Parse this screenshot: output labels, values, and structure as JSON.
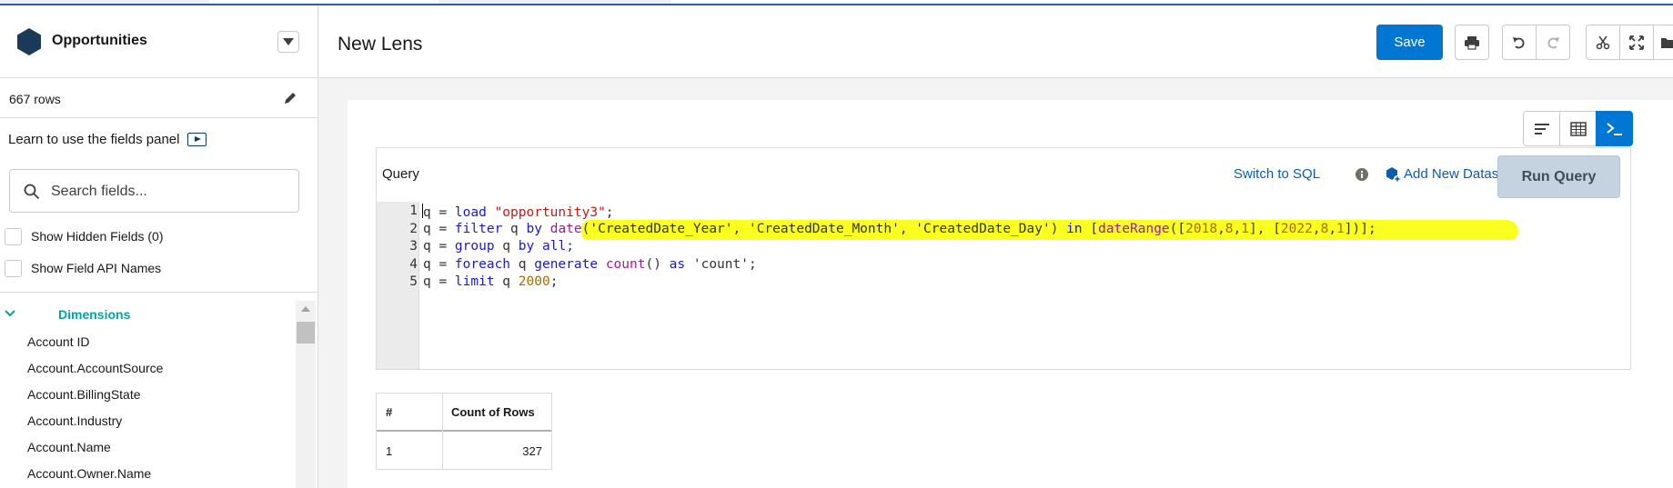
{
  "sidebar": {
    "dataset_title": "Opportunities",
    "row_count": "667 rows",
    "learn_text": "Learn to use the fields panel",
    "search": {
      "placeholder": "Search fields..."
    },
    "show_hidden": "Show Hidden Fields (0)",
    "show_api_names": "Show Field API Names",
    "dimensions_label": "Dimensions",
    "fields": [
      "Account ID",
      "Account.AccountSource",
      "Account.BillingState",
      "Account.Industry",
      "Account.Name",
      "Account.Owner.Name"
    ]
  },
  "header": {
    "lens_title": "New Lens",
    "save_label": "Save"
  },
  "query": {
    "label": "Query",
    "switch_sql": "Switch to SQL",
    "add_dataset": "Add New Dataset",
    "run_label": "Run Query",
    "line_numbers": [
      "1",
      "2",
      "3",
      "4",
      "5"
    ],
    "lines": [
      "q = load \"opportunity3\";",
      "q = filter q by date('CreatedDate_Year', 'CreatedDate_Month', 'CreatedDate_Day') in [dateRange([2018,8,1], [2022,8,1])];",
      "q = group q by all;",
      "q = foreach q generate count() as 'count';",
      "q = limit q 2000;"
    ]
  },
  "results": {
    "headers": [
      "#",
      "Count of Rows"
    ],
    "rows": [
      [
        "1",
        "327"
      ]
    ]
  },
  "colors": {
    "primary": "#0176d3",
    "highlight": "#fbff1f",
    "dimension_accent": "#06a59a",
    "link": "#0b5cab"
  },
  "icons": [
    "dataset-hex-icon",
    "chevron-down-icon",
    "pencil-icon",
    "play-video-icon",
    "search-icon",
    "print-icon",
    "undo-icon",
    "redo-icon",
    "scissors-icon",
    "expand-icon",
    "folder-icon",
    "list-view-icon",
    "table-view-icon",
    "terminal-icon",
    "info-icon",
    "add-dataset-icon"
  ]
}
